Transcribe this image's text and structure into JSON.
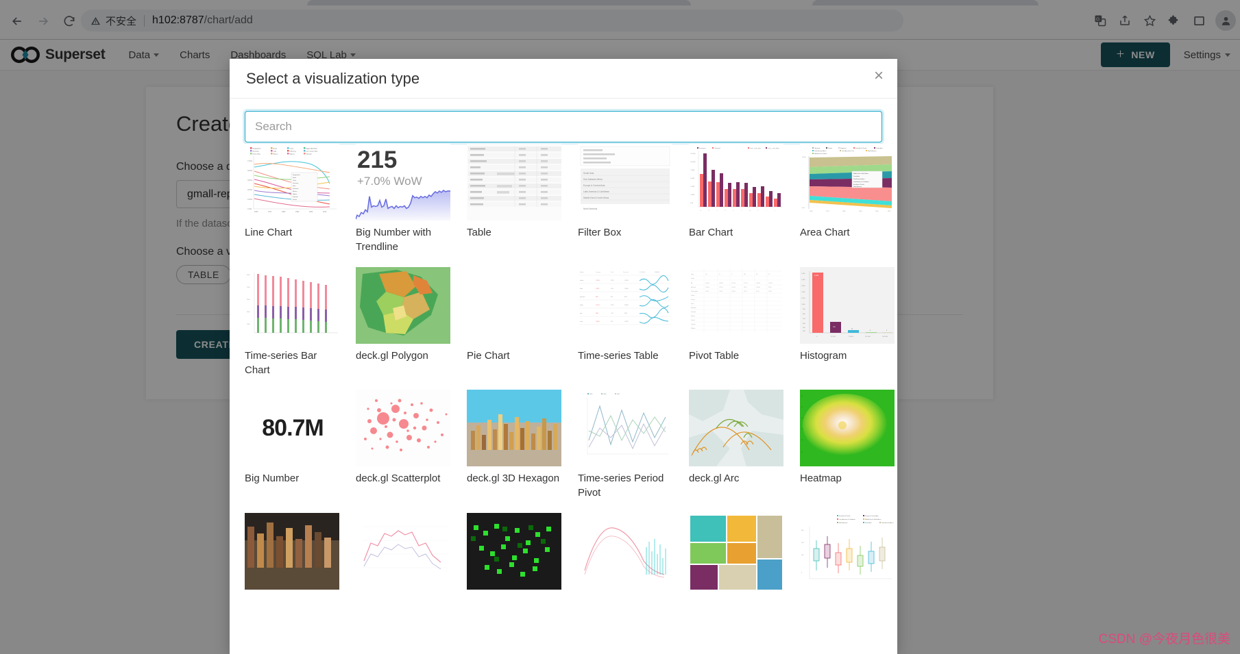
{
  "browser": {
    "back_icon": "back-arrow-icon",
    "forward_icon": "forward-arrow-icon",
    "reload_icon": "reload-icon",
    "insecure_label": "不安全",
    "warning_icon": "warning-triangle-icon",
    "url_host": "h102:8787",
    "url_path": "/chart/add",
    "actions": [
      {
        "name": "translate-icon",
        "glyph": "G"
      },
      {
        "name": "share-icon",
        "glyph": ""
      },
      {
        "name": "bookmark-star-icon",
        "glyph": ""
      },
      {
        "name": "extensions-puzzle-icon",
        "glyph": ""
      },
      {
        "name": "side-panel-icon",
        "glyph": ""
      },
      {
        "name": "profile-avatar-icon",
        "glyph": ""
      }
    ]
  },
  "navbar": {
    "brand": "Superset",
    "items": [
      {
        "label": "Data",
        "has_caret": true
      },
      {
        "label": "Charts",
        "has_caret": false
      },
      {
        "label": "Dashboards",
        "has_caret": false
      },
      {
        "label": "SQL Lab",
        "has_caret": true
      }
    ],
    "new_button": "NEW",
    "new_button_color": "#16555e",
    "settings": "Settings"
  },
  "create_chart_page": {
    "title": "Create a new chart",
    "datasource_label": "Choose a datasource",
    "datasource_value": "gmall-report.ads_user_topic",
    "help_text": "If the datasource you are looking for is not available in the list, follow the instructions on how to add it in the Superset tutorial.",
    "viz_label": "Choose a visualization type",
    "viz_tag": "TABLE",
    "create_button": "CREATE NEW CHART"
  },
  "modal": {
    "title": "Select a visualization type",
    "close_icon": "close-icon",
    "search": {
      "placeholder": "Search",
      "value": ""
    },
    "accent_color": "#20a7c9",
    "viz_types": [
      {
        "label": "Line Chart",
        "thumb": "line-chart-thumb"
      },
      {
        "label": "Big Number with Trendline",
        "thumb": "big-number-trendline-thumb",
        "big_value": "215",
        "big_delta": "+7.0% WoW"
      },
      {
        "label": "Table",
        "thumb": "table-thumb"
      },
      {
        "label": "Filter Box",
        "thumb": "filter-box-thumb"
      },
      {
        "label": "Bar Chart",
        "thumb": "bar-chart-thumb"
      },
      {
        "label": "Area Chart",
        "thumb": "area-chart-thumb"
      },
      {
        "label": "Time-series Bar Chart",
        "thumb": "time-series-bar-chart-thumb"
      },
      {
        "label": "deck.gl Polygon",
        "thumb": "deckgl-polygon-thumb"
      },
      {
        "label": "Pie Chart",
        "thumb": "pie-chart-thumb"
      },
      {
        "label": "Time-series Table",
        "thumb": "time-series-table-thumb"
      },
      {
        "label": "Pivot Table",
        "thumb": "pivot-table-thumb"
      },
      {
        "label": "Histogram",
        "thumb": "histogram-thumb"
      },
      {
        "label": "Big Number",
        "thumb": "big-number-thumb",
        "big_value": "80.7M"
      },
      {
        "label": "deck.gl Scatterplot",
        "thumb": "deckgl-scatterplot-thumb"
      },
      {
        "label": "deck.gl 3D Hexagon",
        "thumb": "deckgl-3d-hexagon-thumb"
      },
      {
        "label": "Time-series Period Pivot",
        "thumb": "time-series-period-pivot-thumb"
      },
      {
        "label": "deck.gl Arc",
        "thumb": "deckgl-arc-thumb"
      },
      {
        "label": "Heatmap",
        "thumb": "heatmap-thumb"
      },
      {
        "label": "",
        "thumb": "row-four-a-thumb"
      },
      {
        "label": "",
        "thumb": "row-four-b-thumb"
      },
      {
        "label": "",
        "thumb": "row-four-c-thumb"
      },
      {
        "label": "",
        "thumb": "row-four-d-thumb"
      },
      {
        "label": "",
        "thumb": "row-four-e-thumb"
      },
      {
        "label": "",
        "thumb": "row-four-f-thumb"
      }
    ]
  },
  "watermark": "CSDN @今夜月色很美"
}
